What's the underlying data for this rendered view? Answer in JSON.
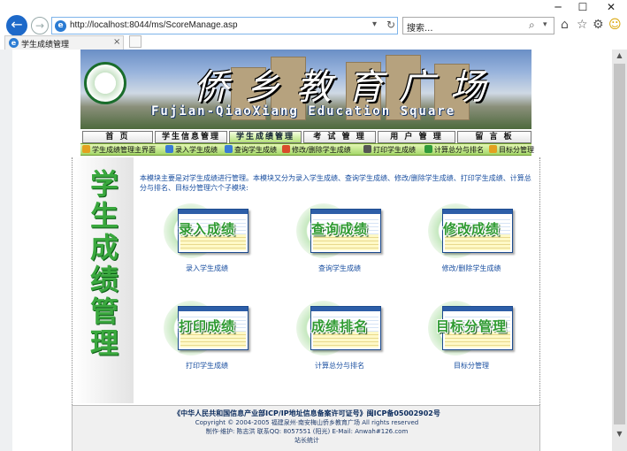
{
  "browser": {
    "url": "http://localhost:8044/ms/ScoreManage.asp",
    "search_placeholder": "搜索...",
    "tab_title": "学生成绩管理",
    "window_controls": [
      "─",
      "☐",
      "✕"
    ]
  },
  "banner": {
    "title": "侨乡教育广场",
    "subtitle": "Fujian-QiaoXiang Education Square"
  },
  "top_nav": [
    {
      "label": "首 页"
    },
    {
      "label": "学生信息管理"
    },
    {
      "label": "学生成绩管理",
      "active": true
    },
    {
      "label": "考 试 管 理"
    },
    {
      "label": "用 户 管 理"
    },
    {
      "label": "留 言 板"
    }
  ],
  "sub_nav": [
    {
      "label": "学生成绩管理主界面",
      "icon": "home-icon",
      "color": "#e3a11f"
    },
    {
      "label": "录入学生成绩",
      "icon": "edit-icon",
      "color": "#3a7bd5"
    },
    {
      "label": "查询学生成绩",
      "icon": "search-icon",
      "color": "#3a7bd5"
    },
    {
      "label": "修改/删除学生成绩",
      "icon": "modify-icon",
      "color": "#d94b2b"
    },
    {
      "label": "打印学生成绩",
      "icon": "printer-icon",
      "color": "#555555"
    },
    {
      "label": "计算总分与排名",
      "icon": "calc-icon",
      "color": "#2f9a3a"
    },
    {
      "label": "目标分管理",
      "icon": "target-icon",
      "color": "#e3a11f"
    }
  ],
  "section_title": "学生成绩管理",
  "intro_text": "本模块主要是对学生成绩进行管理。本模块又分为录入学生成绩、查询学生成绩、修改/删除学生成绩、打印学生成绩、计算总分与排名、目标分管理六个子模块:",
  "modules": [
    {
      "title": "录入成绩",
      "label": "录入学生成绩"
    },
    {
      "title": "查询成绩",
      "label": "查询学生成绩"
    },
    {
      "title": "修改成绩",
      "label": "修改/删除学生成绩"
    },
    {
      "title": "打印成绩",
      "label": "打印学生成绩"
    },
    {
      "title": "成绩排名",
      "label": "计算总分与排名"
    },
    {
      "title": "目标分管理",
      "label": "目标分管理"
    }
  ],
  "footer": {
    "line1": "《中华人民共和国信息产业部ICP/IP地址信息备案许可证号》闽ICP备05002902号",
    "line2": "Copyright © 2004-2005 福建泉州·南安梅山侨乡教育广场 All rights reserved",
    "line3": "制作·维护: 陈志洪 联系QQ: 8057551 (阳光) E-Mail: Anwah#126.com",
    "line4": "站长统计"
  },
  "colors": {
    "accent_green": "#3aa83e",
    "link_blue": "#1a4fa0",
    "subnav_green": "#a5d76a"
  }
}
